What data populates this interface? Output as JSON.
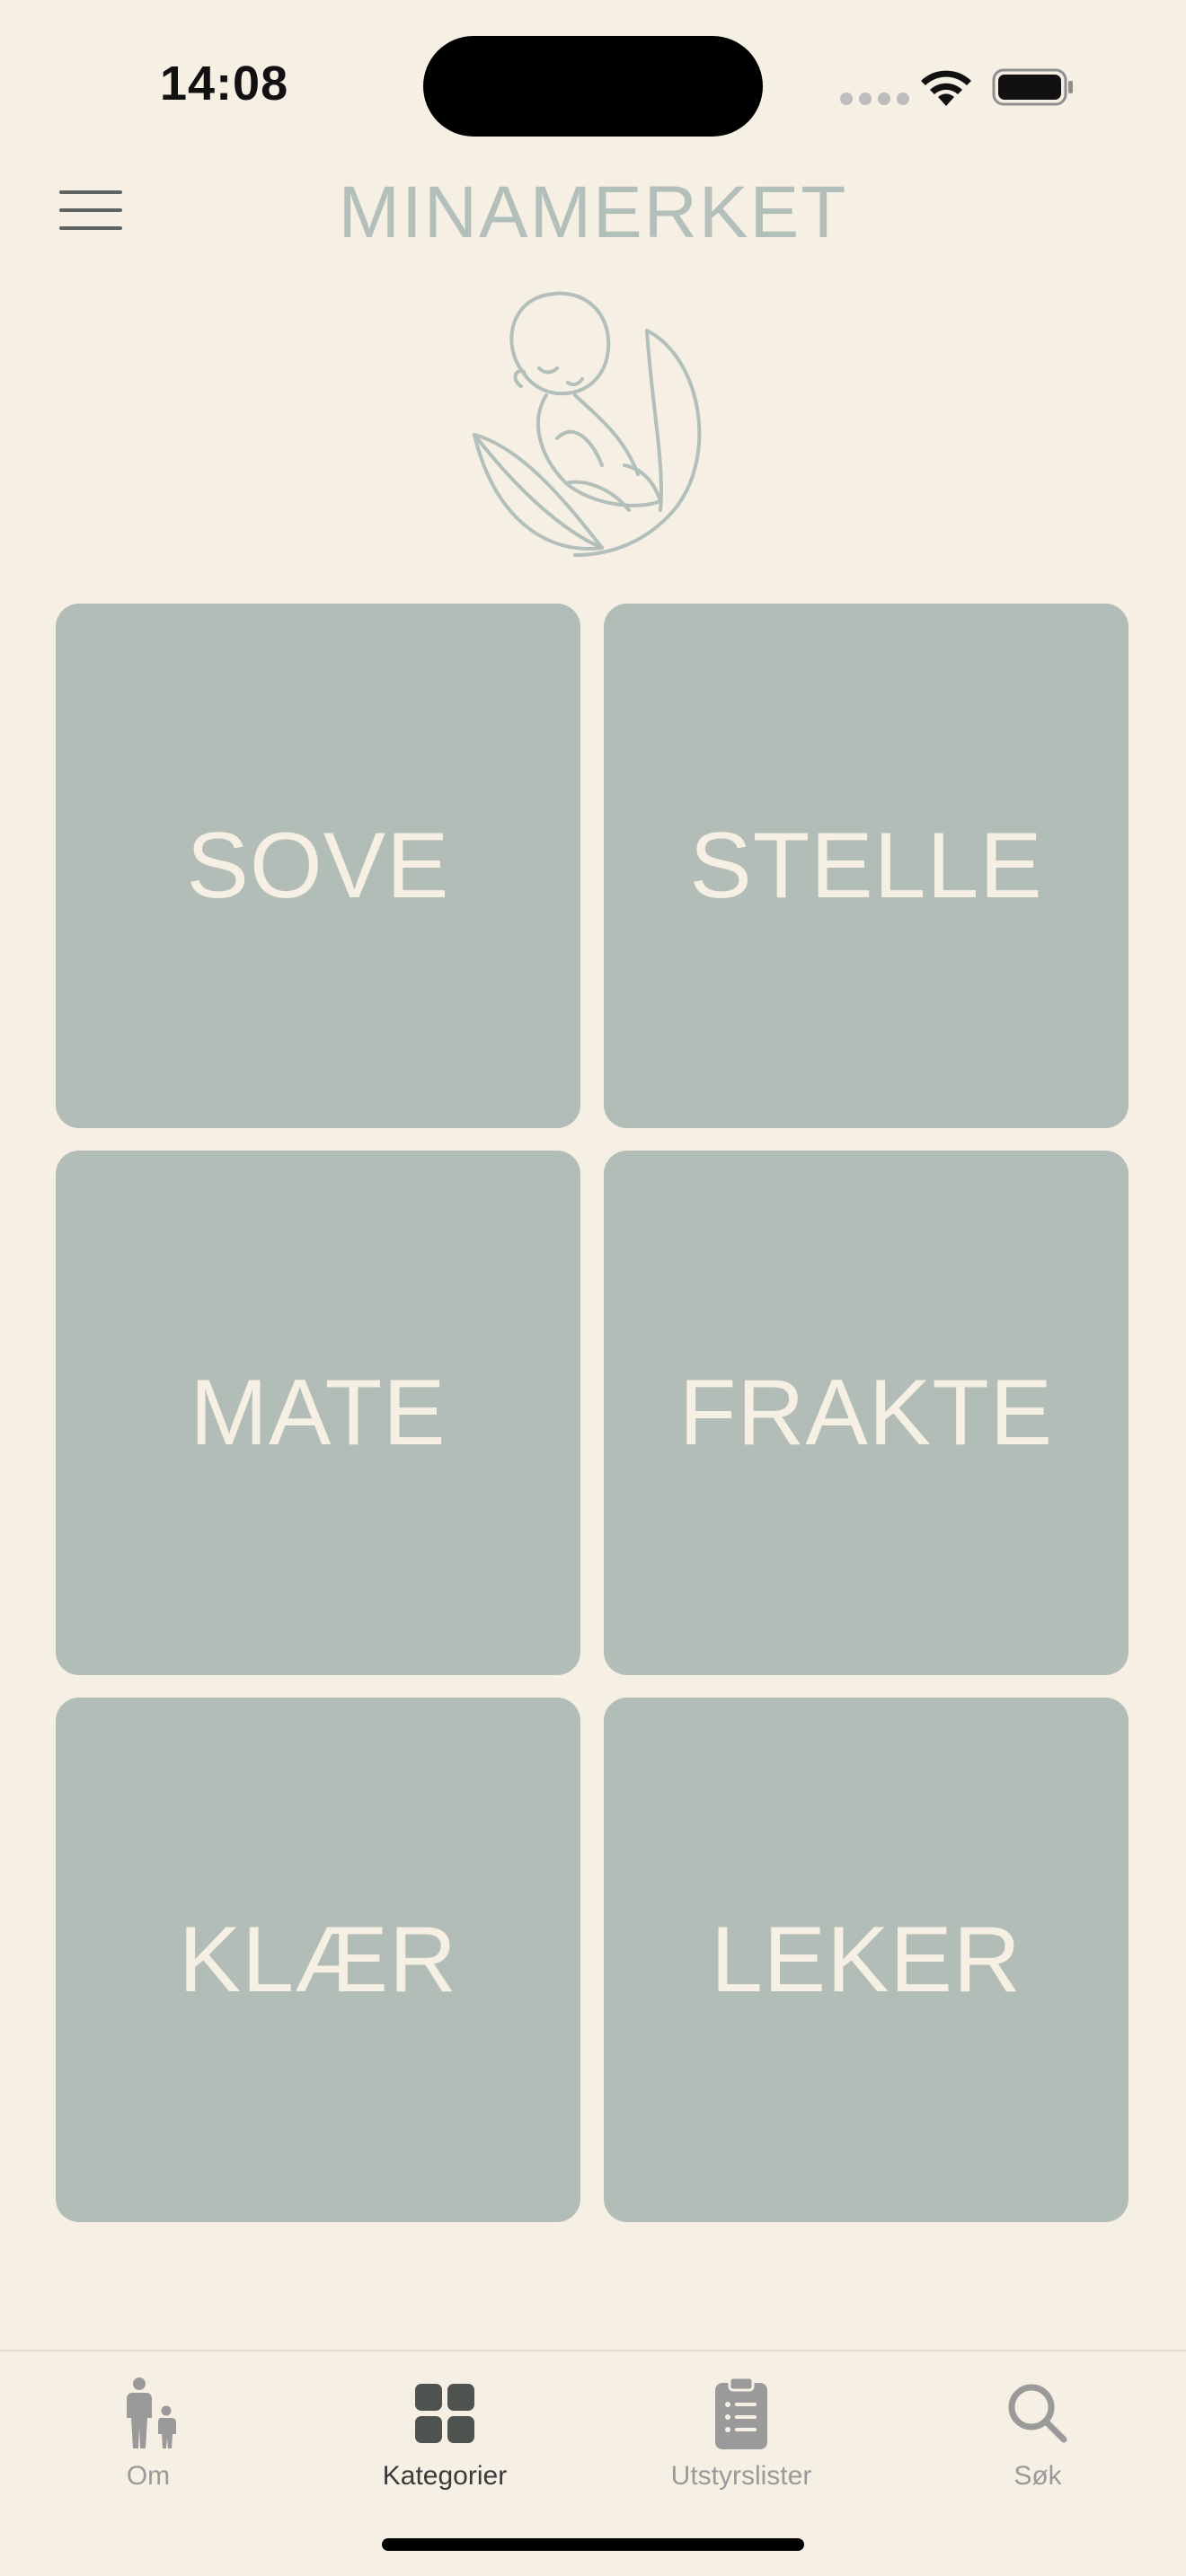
{
  "status_bar": {
    "time": "14:08"
  },
  "header": {
    "title": "MINAMERKET",
    "menu_icon": "hamburger-menu-icon",
    "logo_icon": "baby-leaf-logo-icon"
  },
  "categories": [
    {
      "label": "SOVE"
    },
    {
      "label": "STELLE"
    },
    {
      "label": "MATE"
    },
    {
      "label": "FRAKTE"
    },
    {
      "label": "KLÆR"
    },
    {
      "label": "LEKER"
    }
  ],
  "tabbar": {
    "tabs": [
      {
        "label": "Om",
        "icon": "parent-child-icon",
        "active": false
      },
      {
        "label": "Kategorier",
        "icon": "grid-icon",
        "active": true
      },
      {
        "label": "Utstyrslister",
        "icon": "clipboard-list-icon",
        "active": false
      },
      {
        "label": "Søk",
        "icon": "search-icon",
        "active": false
      }
    ]
  },
  "colors": {
    "background": "#f6efe4",
    "tile": "#b3bdb7",
    "tile_text": "#f6efe4",
    "title": "#b3bfba",
    "tab_active": "#3a3a3a",
    "tab_inactive": "#9a9a9a"
  }
}
